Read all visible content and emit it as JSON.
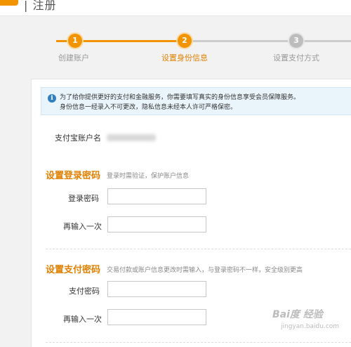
{
  "header": {
    "title": "| 注册"
  },
  "steps": [
    {
      "number": "1",
      "label": "创建账户",
      "state": "done"
    },
    {
      "number": "2",
      "label": "设置身份信息",
      "state": "active"
    },
    {
      "number": "3",
      "label": "设置支付方式",
      "state": "pending"
    }
  ],
  "colors": {
    "accent": "#f29400",
    "pending": "#cccccc",
    "section_title": "#e08000",
    "notice_bg": "#eaf4fb",
    "info_icon": "#2f7fc1"
  },
  "notice": {
    "icon": "info-icon",
    "line1": "为了给你提供更好的支付和金融服务，你需要填写真实的身份信息享受会员保障服务。",
    "line2": "身份信息一经录入不可更改，隐私信息未经本人许可严格保密。"
  },
  "account": {
    "label": "支付宝账户名"
  },
  "login_password": {
    "title": "设置登录密码",
    "desc": "登录时需验证，保护账户信息",
    "password_label": "登录密码",
    "confirm_label": "再输入一次",
    "password_value": "",
    "confirm_value": ""
  },
  "pay_password": {
    "title": "设置支付密码",
    "desc": "交易付款或账户信息更改时需输入，与登录密码不一样，安全级别更高",
    "password_label": "支付密码",
    "confirm_label": "再输入一次",
    "password_value": "",
    "confirm_value": ""
  },
  "watermark": {
    "brand": "Bai度 经验",
    "url": "jingyan.baidu.com"
  }
}
